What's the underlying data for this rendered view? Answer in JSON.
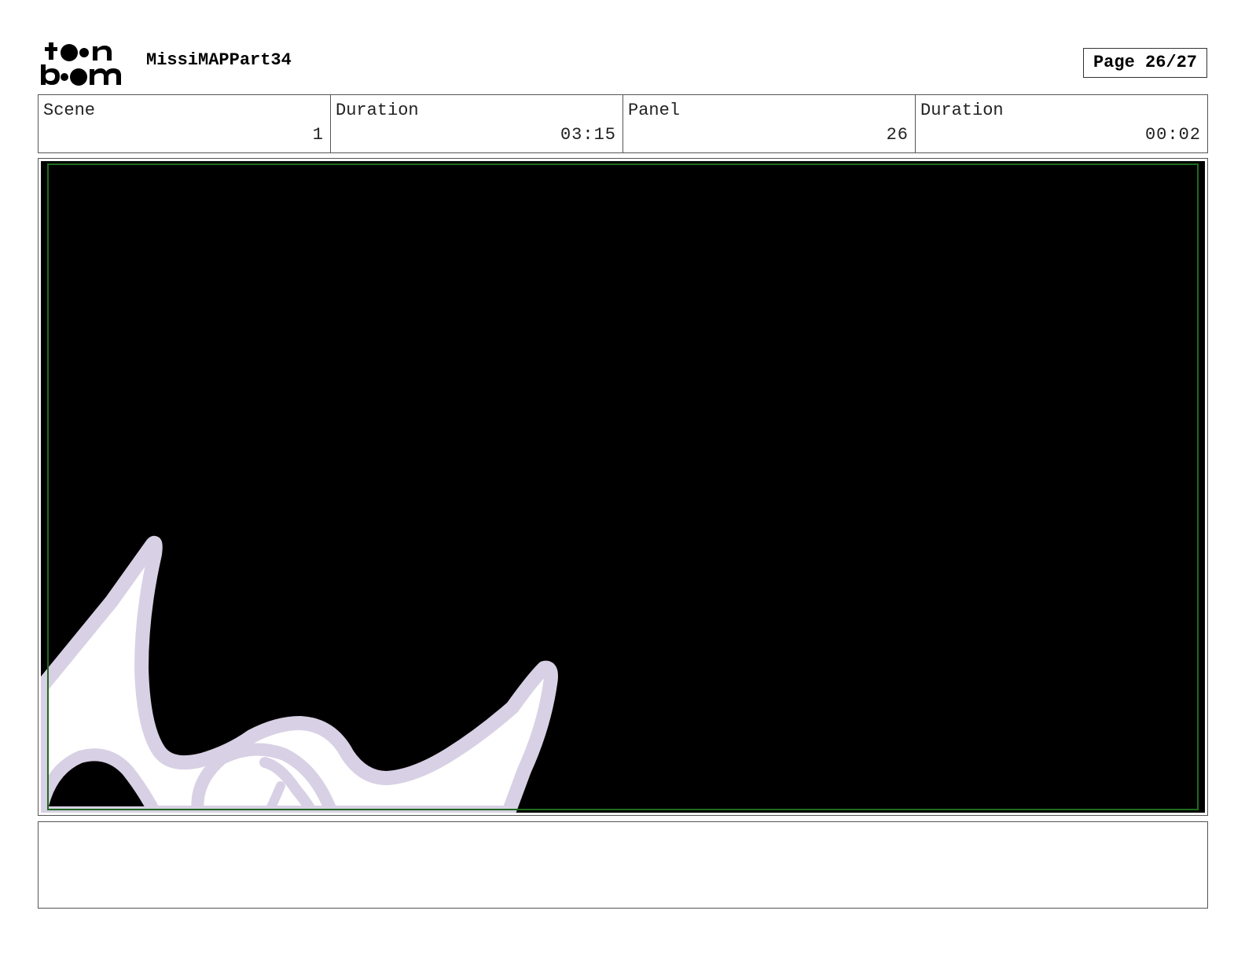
{
  "header": {
    "project_title": "MissiMAPPart34",
    "page_label": "Page 26/27",
    "logo_text": "toon boom"
  },
  "info": {
    "scene_label": "Scene",
    "scene_value": "1",
    "scene_duration_label": "Duration",
    "scene_duration_value": "03:15",
    "panel_label": "Panel",
    "panel_value": "26",
    "panel_duration_label": "Duration",
    "panel_duration_value": "00:02"
  },
  "panel": {
    "background_color": "#000000",
    "drawing_fill_color": "#ffffff",
    "drawing_stroke_color": "#d8d0e4",
    "safe_frame_color": "#1e6b1e"
  },
  "notes": {
    "text": ""
  }
}
